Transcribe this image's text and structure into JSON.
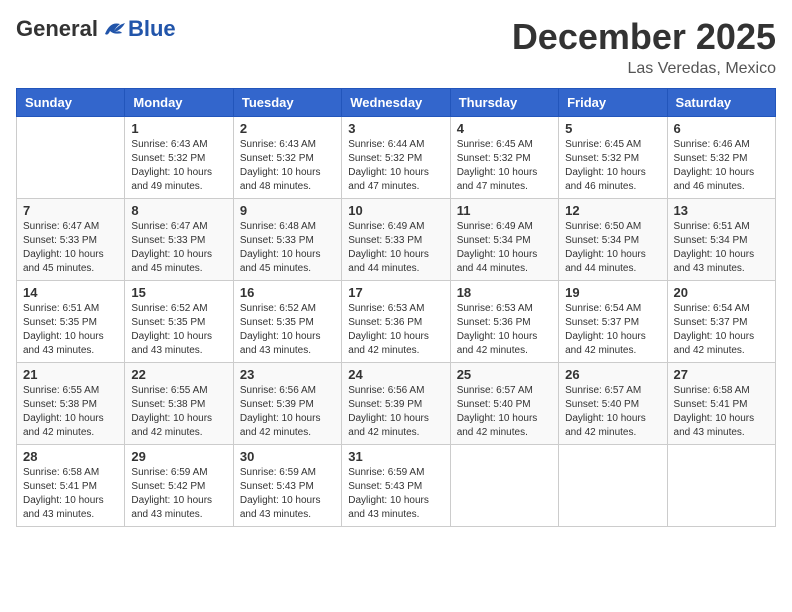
{
  "header": {
    "logo": {
      "general": "General",
      "blue": "Blue"
    },
    "title": "December 2025",
    "location": "Las Veredas, Mexico"
  },
  "days_of_week": [
    "Sunday",
    "Monday",
    "Tuesday",
    "Wednesday",
    "Thursday",
    "Friday",
    "Saturday"
  ],
  "weeks": [
    [
      {
        "day": null,
        "data": null
      },
      {
        "day": 1,
        "data": {
          "sunrise": "6:43 AM",
          "sunset": "5:32 PM",
          "daylight": "10 hours and 49 minutes."
        }
      },
      {
        "day": 2,
        "data": {
          "sunrise": "6:43 AM",
          "sunset": "5:32 PM",
          "daylight": "10 hours and 48 minutes."
        }
      },
      {
        "day": 3,
        "data": {
          "sunrise": "6:44 AM",
          "sunset": "5:32 PM",
          "daylight": "10 hours and 47 minutes."
        }
      },
      {
        "day": 4,
        "data": {
          "sunrise": "6:45 AM",
          "sunset": "5:32 PM",
          "daylight": "10 hours and 47 minutes."
        }
      },
      {
        "day": 5,
        "data": {
          "sunrise": "6:45 AM",
          "sunset": "5:32 PM",
          "daylight": "10 hours and 46 minutes."
        }
      },
      {
        "day": 6,
        "data": {
          "sunrise": "6:46 AM",
          "sunset": "5:32 PM",
          "daylight": "10 hours and 46 minutes."
        }
      }
    ],
    [
      {
        "day": 7,
        "data": {
          "sunrise": "6:47 AM",
          "sunset": "5:33 PM",
          "daylight": "10 hours and 45 minutes."
        }
      },
      {
        "day": 8,
        "data": {
          "sunrise": "6:47 AM",
          "sunset": "5:33 PM",
          "daylight": "10 hours and 45 minutes."
        }
      },
      {
        "day": 9,
        "data": {
          "sunrise": "6:48 AM",
          "sunset": "5:33 PM",
          "daylight": "10 hours and 45 minutes."
        }
      },
      {
        "day": 10,
        "data": {
          "sunrise": "6:49 AM",
          "sunset": "5:33 PM",
          "daylight": "10 hours and 44 minutes."
        }
      },
      {
        "day": 11,
        "data": {
          "sunrise": "6:49 AM",
          "sunset": "5:34 PM",
          "daylight": "10 hours and 44 minutes."
        }
      },
      {
        "day": 12,
        "data": {
          "sunrise": "6:50 AM",
          "sunset": "5:34 PM",
          "daylight": "10 hours and 44 minutes."
        }
      },
      {
        "day": 13,
        "data": {
          "sunrise": "6:51 AM",
          "sunset": "5:34 PM",
          "daylight": "10 hours and 43 minutes."
        }
      }
    ],
    [
      {
        "day": 14,
        "data": {
          "sunrise": "6:51 AM",
          "sunset": "5:35 PM",
          "daylight": "10 hours and 43 minutes."
        }
      },
      {
        "day": 15,
        "data": {
          "sunrise": "6:52 AM",
          "sunset": "5:35 PM",
          "daylight": "10 hours and 43 minutes."
        }
      },
      {
        "day": 16,
        "data": {
          "sunrise": "6:52 AM",
          "sunset": "5:35 PM",
          "daylight": "10 hours and 43 minutes."
        }
      },
      {
        "day": 17,
        "data": {
          "sunrise": "6:53 AM",
          "sunset": "5:36 PM",
          "daylight": "10 hours and 42 minutes."
        }
      },
      {
        "day": 18,
        "data": {
          "sunrise": "6:53 AM",
          "sunset": "5:36 PM",
          "daylight": "10 hours and 42 minutes."
        }
      },
      {
        "day": 19,
        "data": {
          "sunrise": "6:54 AM",
          "sunset": "5:37 PM",
          "daylight": "10 hours and 42 minutes."
        }
      },
      {
        "day": 20,
        "data": {
          "sunrise": "6:54 AM",
          "sunset": "5:37 PM",
          "daylight": "10 hours and 42 minutes."
        }
      }
    ],
    [
      {
        "day": 21,
        "data": {
          "sunrise": "6:55 AM",
          "sunset": "5:38 PM",
          "daylight": "10 hours and 42 minutes."
        }
      },
      {
        "day": 22,
        "data": {
          "sunrise": "6:55 AM",
          "sunset": "5:38 PM",
          "daylight": "10 hours and 42 minutes."
        }
      },
      {
        "day": 23,
        "data": {
          "sunrise": "6:56 AM",
          "sunset": "5:39 PM",
          "daylight": "10 hours and 42 minutes."
        }
      },
      {
        "day": 24,
        "data": {
          "sunrise": "6:56 AM",
          "sunset": "5:39 PM",
          "daylight": "10 hours and 42 minutes."
        }
      },
      {
        "day": 25,
        "data": {
          "sunrise": "6:57 AM",
          "sunset": "5:40 PM",
          "daylight": "10 hours and 42 minutes."
        }
      },
      {
        "day": 26,
        "data": {
          "sunrise": "6:57 AM",
          "sunset": "5:40 PM",
          "daylight": "10 hours and 42 minutes."
        }
      },
      {
        "day": 27,
        "data": {
          "sunrise": "6:58 AM",
          "sunset": "5:41 PM",
          "daylight": "10 hours and 43 minutes."
        }
      }
    ],
    [
      {
        "day": 28,
        "data": {
          "sunrise": "6:58 AM",
          "sunset": "5:41 PM",
          "daylight": "10 hours and 43 minutes."
        }
      },
      {
        "day": 29,
        "data": {
          "sunrise": "6:59 AM",
          "sunset": "5:42 PM",
          "daylight": "10 hours and 43 minutes."
        }
      },
      {
        "day": 30,
        "data": {
          "sunrise": "6:59 AM",
          "sunset": "5:43 PM",
          "daylight": "10 hours and 43 minutes."
        }
      },
      {
        "day": 31,
        "data": {
          "sunrise": "6:59 AM",
          "sunset": "5:43 PM",
          "daylight": "10 hours and 43 minutes."
        }
      },
      {
        "day": null,
        "data": null
      },
      {
        "day": null,
        "data": null
      },
      {
        "day": null,
        "data": null
      }
    ]
  ]
}
